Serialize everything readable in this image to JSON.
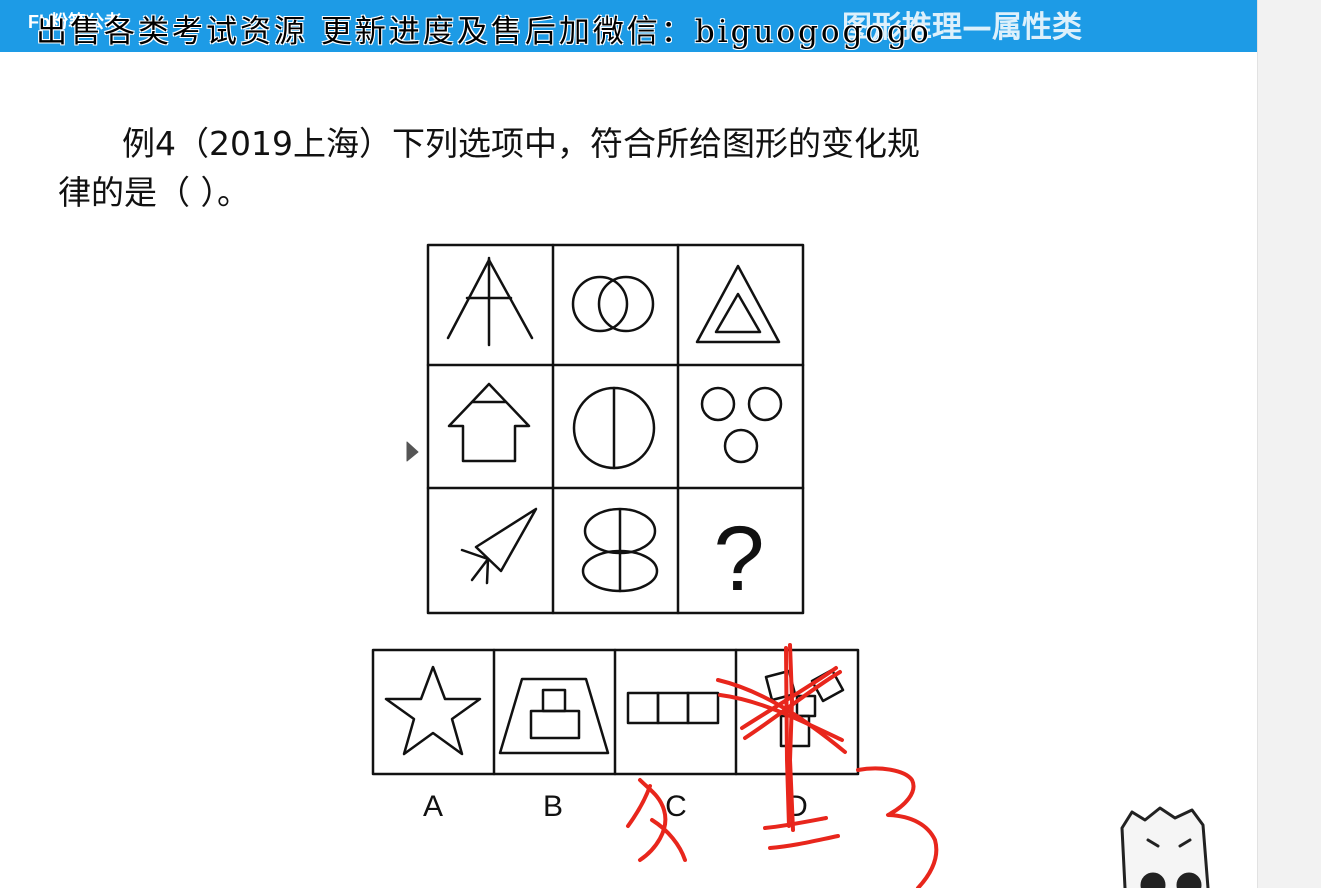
{
  "header": {
    "logo": "Fb粉笔公考",
    "section_title": "图形推理—属性类",
    "watermark": "出售各类考试资源 更新进度及售后加微信：biguogogogo"
  },
  "question": {
    "line1": "例4（2019上海）下列选项中，符合所给图形的变化规",
    "line2": "律的是（ ）。"
  },
  "puzzle": {
    "question_mark": "?"
  },
  "options": [
    {
      "label": "A"
    },
    {
      "label": "B"
    },
    {
      "label": "C"
    },
    {
      "label": "D"
    }
  ],
  "annotations": {
    "color": "#e8261c"
  },
  "colors": {
    "header_bg": "#1d9be6",
    "line": "#111111"
  }
}
